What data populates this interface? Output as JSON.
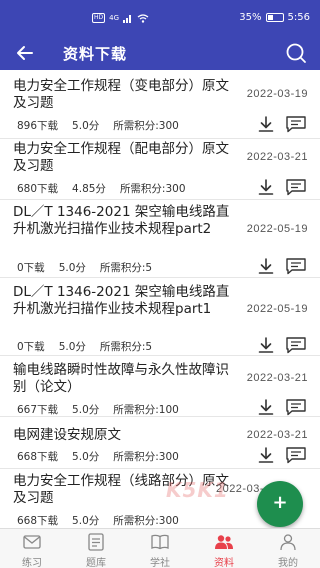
{
  "status": {
    "carrier": "HD",
    "signal": "4G",
    "battery": "35%",
    "time": "5:56"
  },
  "header": {
    "title": "资料下载",
    "back_icon": "arrow-left-icon",
    "search_icon": "search-icon"
  },
  "items": [
    {
      "title": "电力安全工作规程（变电部分）原文及习题",
      "date": "2022-03-19",
      "downloads": "896下载",
      "rating": "5.0分",
      "points": "所需积分:300"
    },
    {
      "title": "电力安全工作规程（配电部分）原文及习题",
      "date": "2022-03-21",
      "downloads": "680下载",
      "rating": "4.85分",
      "points": "所需积分:300"
    },
    {
      "title": "DL／T 1346-2021 架空输电线路直升机激光扫描作业技术规程part2",
      "date": "2022-05-19",
      "downloads": "0下载",
      "rating": "5.0分",
      "points": "所需积分:5"
    },
    {
      "title": "DL／T 1346-2021 架空输电线路直升机激光扫描作业技术规程part1",
      "date": "2022-05-19",
      "downloads": "0下载",
      "rating": "5.0分",
      "points": "所需积分:5"
    },
    {
      "title": "输电线路瞬时性故障与永久性故障识别（论文）",
      "date": "2022-03-21",
      "downloads": "667下载",
      "rating": "5.0分",
      "points": "所需积分:100"
    },
    {
      "title": "电网建设安规原文",
      "date": "2022-03-21",
      "downloads": "668下载",
      "rating": "5.0分",
      "points": "所需积分:300"
    },
    {
      "title": "电力安全工作规程（线路部分）原文及习题",
      "date": "2022-03-",
      "downloads": "668下载",
      "rating": "5.0分",
      "points": "所需积分:300"
    }
  ],
  "watermark": "K5K1",
  "fab": {
    "label": "+",
    "color": "#1e8e4e"
  },
  "tabs": [
    {
      "label": "练习",
      "icon": "mail-icon",
      "active": false
    },
    {
      "label": "题库",
      "icon": "document-icon",
      "active": false
    },
    {
      "label": "学社",
      "icon": "book-icon",
      "active": false
    },
    {
      "label": "资料",
      "icon": "people-icon",
      "active": true
    },
    {
      "label": "我的",
      "icon": "person-icon",
      "active": false
    }
  ],
  "colors": {
    "primary": "#3d46b4",
    "active_tab": "#e8414b"
  }
}
